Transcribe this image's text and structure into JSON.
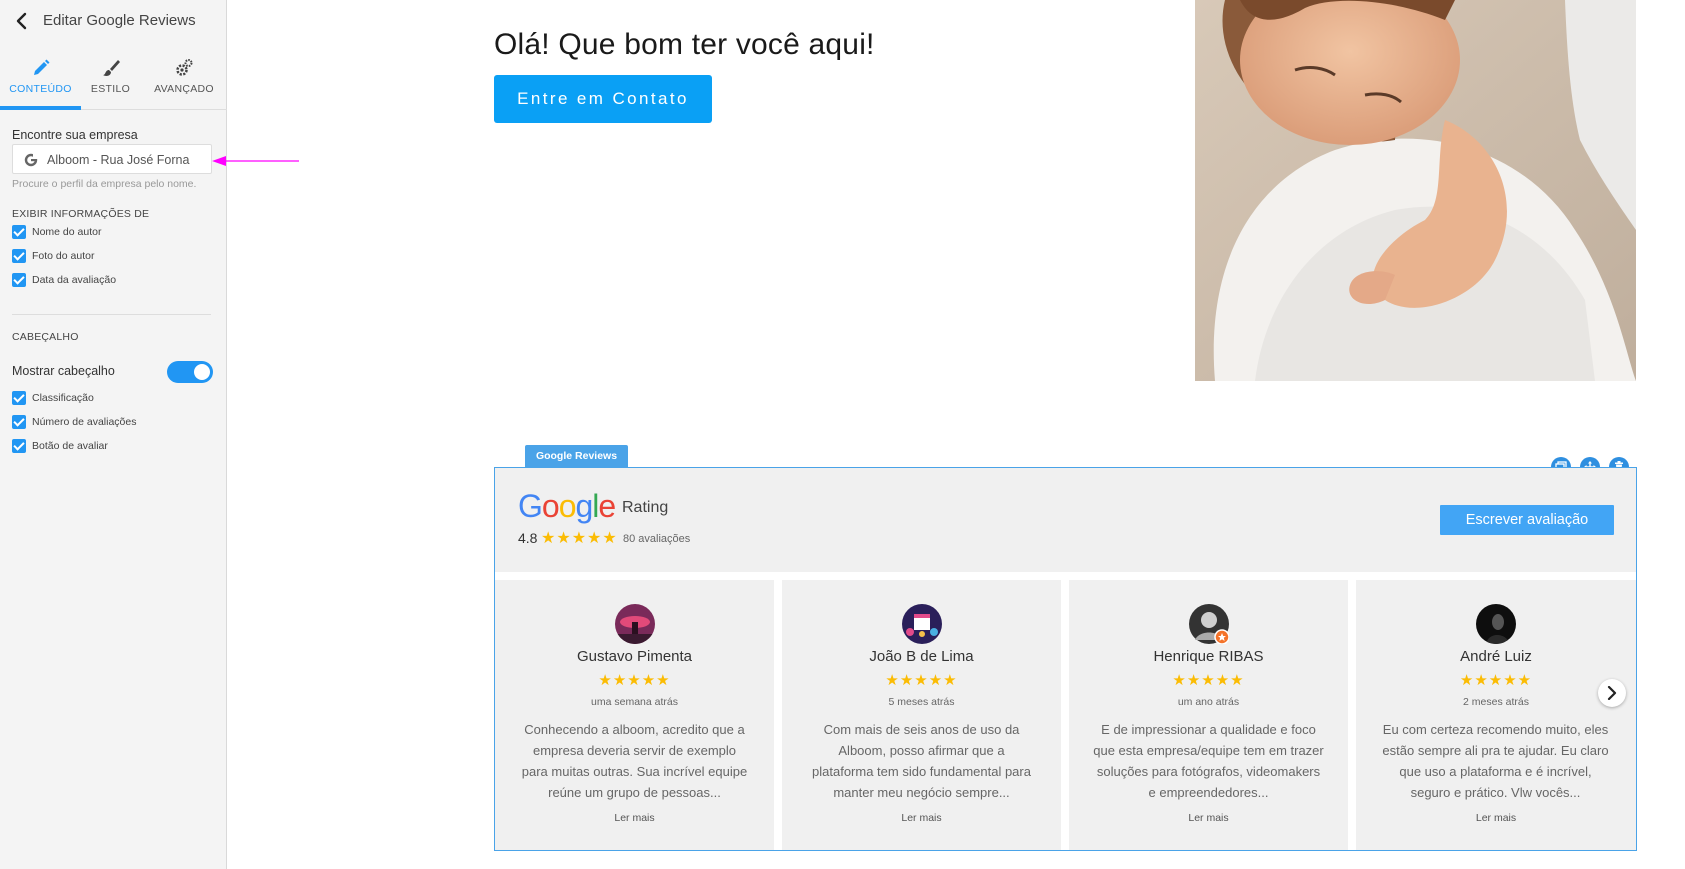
{
  "sidebar": {
    "title": "Editar Google Reviews",
    "tabs": [
      {
        "label": "CONTEÚDO",
        "icon": "pencil-icon"
      },
      {
        "label": "ESTILO",
        "icon": "brush-icon"
      },
      {
        "label": "AVANÇADO",
        "icon": "gears-icon"
      }
    ],
    "find_company_label": "Encontre sua empresa",
    "search_value": "Alboom - Rua José Forna",
    "search_help": "Procure o perfil da empresa pelo nome.",
    "show_info_section": "EXIBIR INFORMAÇÕES DE",
    "show_info_options": [
      {
        "label": "Nome do autor",
        "checked": true
      },
      {
        "label": "Foto do autor",
        "checked": true
      },
      {
        "label": "Data da avaliação",
        "checked": true
      }
    ],
    "header_section": "CABEÇALHO",
    "show_header_label": "Mostrar cabeçalho",
    "show_header_on": true,
    "header_options": [
      {
        "label": "Classificação",
        "checked": true
      },
      {
        "label": "Número de avaliações",
        "checked": true
      },
      {
        "label": "Botão de avaliar",
        "checked": true
      }
    ]
  },
  "hero": {
    "title": "Olá! Que bom ter você aqui!",
    "cta_label": "Entre em Contato"
  },
  "widget": {
    "tag": "Google Reviews",
    "logo_text": "Google",
    "rating_word": "Rating",
    "rating_value": "4.8",
    "rating_stars": "★★★★★",
    "review_count": "80 avaliações",
    "write_button": "Escrever avaliação",
    "reviews": [
      {
        "name": "Gustavo Pimenta",
        "stars": "★★★★★",
        "date": "uma semana atrás",
        "text": "Conhecendo a alboom, acredito que a empresa deveria servir de exemplo para muitas outras. Sua incrível equipe reúne um grupo de pessoas...",
        "more": "Ler mais"
      },
      {
        "name": "João B de Lima",
        "stars": "★★★★★",
        "date": "5 meses atrás",
        "text": "Com mais de seis anos de uso da Alboom, posso afirmar que a plataforma tem sido fundamental para manter meu negócio sempre...",
        "more": "Ler mais"
      },
      {
        "name": "Henrique RIBAS",
        "stars": "★★★★★",
        "date": "um ano atrás",
        "text": "E de impressionar a qualidade e foco que esta empresa/equipe tem em trazer soluções para fotógrafos, videomakers e empreendedores...",
        "more": "Ler mais"
      },
      {
        "name": "André Luiz",
        "stars": "★★★★★",
        "date": "2 meses atrás",
        "text": "Eu com certeza recomendo muito, eles estão sempre ali pra te ajudar. Eu claro que uso a plataforma e é incrível, seguro e prático. Vlw vocês...",
        "more": "Ler mais"
      }
    ]
  },
  "colors": {
    "accent": "#2196f3",
    "cta": "#0aa0f5",
    "star": "#fbbc04",
    "annotation_arrow": "#ff00ff"
  }
}
